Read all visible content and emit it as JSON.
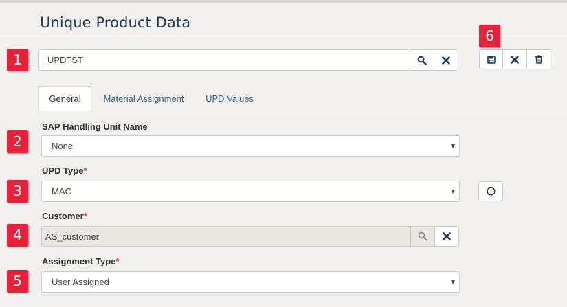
{
  "page": {
    "title": "Unique Product Data"
  },
  "badges": {
    "b1": "1",
    "b2": "2",
    "b3": "3",
    "b4": "4",
    "b5": "5",
    "b6": "6"
  },
  "search": {
    "value": "UPDTST"
  },
  "tabs": [
    {
      "label": "General",
      "active": true
    },
    {
      "label": "Material Assignment",
      "active": false
    },
    {
      "label": "UPD Values",
      "active": false
    }
  ],
  "form": {
    "sap_handling_unit": {
      "label": "SAP Handling Unit Name",
      "value": "None"
    },
    "upd_type": {
      "label": "UPD Type",
      "required_mark": "*",
      "value": "MAC"
    },
    "customer": {
      "label": "Customer",
      "required_mark": "*",
      "value": "AS_customer"
    },
    "assignment_type": {
      "label": "Assignment Type",
      "required_mark": "*",
      "value": "User Assigned"
    }
  },
  "colors": {
    "accent_blue": "#1f3a4d",
    "badge_red": "#e3223b",
    "link_blue": "#2a6a8f",
    "required_red": "#c9302c"
  },
  "icons": {
    "search": "search-icon",
    "clear": "close-icon",
    "save": "save-icon",
    "cancel": "close-icon",
    "delete": "trash-icon",
    "info": "info-icon"
  }
}
